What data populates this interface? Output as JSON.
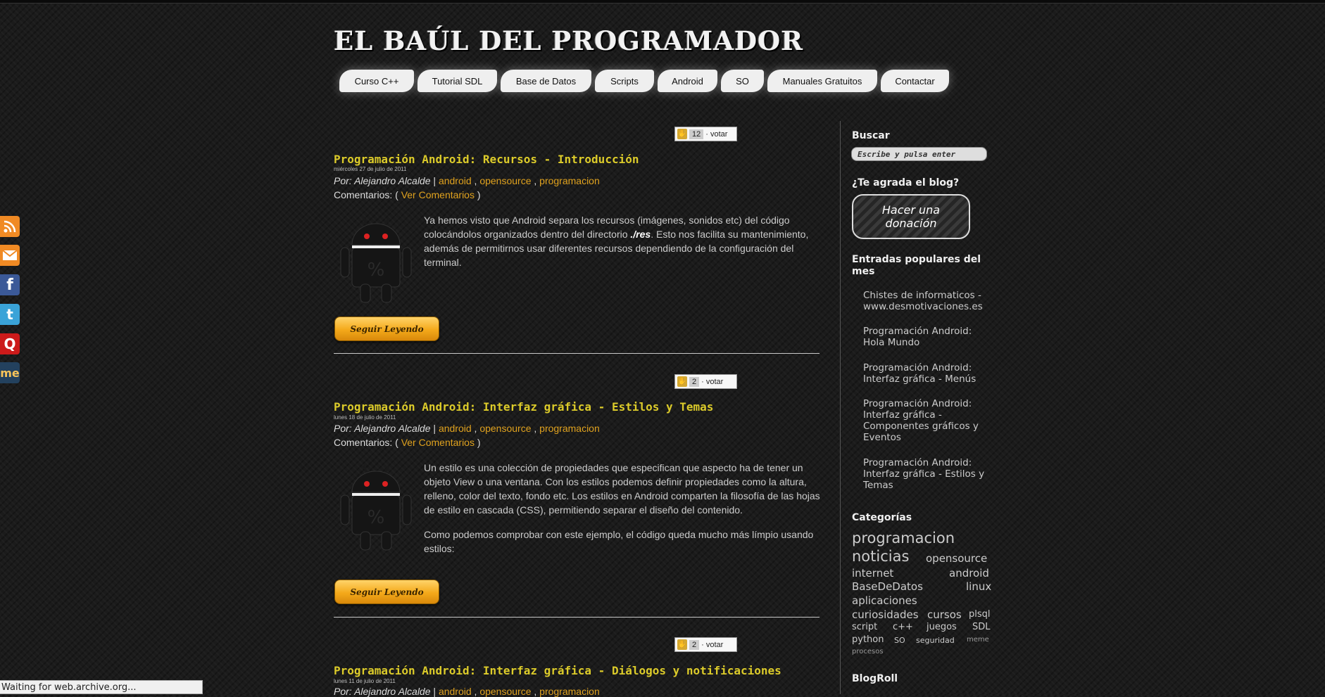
{
  "site": {
    "title": "EL BAÚL DEL PROGRAMADOR"
  },
  "nav": {
    "items": [
      "Curso C++",
      "Tutorial SDL",
      "Base de Datos",
      "Scripts",
      "Android",
      "SO",
      "Manuales Gratuitos",
      "Contactar"
    ]
  },
  "social": {
    "icons": [
      "rss-icon",
      "email-icon",
      "facebook-icon",
      "twitter-icon",
      "q-icon",
      "meneame-icon"
    ],
    "meneame_label": "me"
  },
  "posts": [
    {
      "votes": "12",
      "vote_label": "· votar",
      "title": "Programación Android: Recursos - Introducción",
      "date": "miércoles 27 de julio de 2011",
      "by_prefix": "Por:",
      "author": "Alejandro Alcalde",
      "tags": [
        "android",
        "opensource",
        "programacion"
      ],
      "comments_prefix": "Comentarios: (",
      "comments_link": "Ver Comentarios",
      "comments_suffix": ")",
      "body_1a": "Ya hemos visto que Android separa los recursos (imágenes, sonidos etc) del código colocándolos organizados dentro del directorio ",
      "body_1b": "./res",
      "body_1c": ". Esto nos facilita su mantenimiento, además de permitirnos usar diferentes recursos dependiendo de la configuración del terminal.",
      "more": "Seguir Leyendo"
    },
    {
      "votes": "2",
      "vote_label": "· votar",
      "title": "Programación Android: Interfaz gráfica - Estilos y Temas",
      "date": "lunes 18 de julio de 2011",
      "by_prefix": "Por:",
      "author": "Alejandro Alcalde",
      "tags": [
        "android",
        "opensource",
        "programacion"
      ],
      "comments_prefix": "Comentarios: (",
      "comments_link": "Ver Comentarios",
      "comments_suffix": ")",
      "body_1": "Un estilo es una colección de propiedades que especifican que aspecto ha de tener un objeto View o una ventana. Con los estilos podemos definir propiedades como la altura, relleno, color del texto, fondo etc. Los estilos en Android comparten la filosofía de las hojas de estilo en cascada (CSS), permitiendo separar el diseño del contenido.",
      "body_2": "Como podemos comprobar con este ejemplo, el código queda mucho más límpio usando estilos:",
      "more": "Seguir Leyendo"
    },
    {
      "votes": "2",
      "vote_label": "· votar",
      "title": "Programación Android: Interfaz gráfica - Diálogos y notificaciones",
      "date": "lunes 11 de julio de 2011",
      "by_prefix": "Por:",
      "author": "Alejandro Alcalde",
      "tags": [
        "android",
        "opensource",
        "programacion"
      ]
    }
  ],
  "sidebar": {
    "search_title": "Buscar",
    "search_placeholder": "Escribe y pulsa enter",
    "like_title": "¿Te agrada el blog?",
    "donate_label_1": "Hacer una",
    "donate_label_2": "donación",
    "popular_title": "Entradas populares del mes",
    "popular": [
      "Chistes de informaticos - www.desmotivaciones.es",
      "Programación Android: Hola Mundo",
      "Programación Android: Interfaz gráfica - Menús",
      "Programación Android: Interfaz gráfica - Componentes gráficos y Eventos",
      "Programación Android: Interfaz gráfica - Estilos y Temas"
    ],
    "categories_title": "Categorías",
    "categories": [
      "programacion",
      "noticias",
      "opensource",
      "internet",
      "android",
      "BaseDeDatos",
      "linux",
      "aplicaciones",
      "curiosidades",
      "cursos",
      "plsql",
      "script",
      "c++",
      "juegos",
      "SDL",
      "python",
      "SO",
      "seguridad",
      "meme",
      "procesos"
    ],
    "blogroll_title": "BlogRoll"
  },
  "status_bar": "Waiting for web.archive.org...",
  "colors": {
    "title": "#dccb2a",
    "link": "#e0a21e",
    "background": "#1b1b1b"
  }
}
